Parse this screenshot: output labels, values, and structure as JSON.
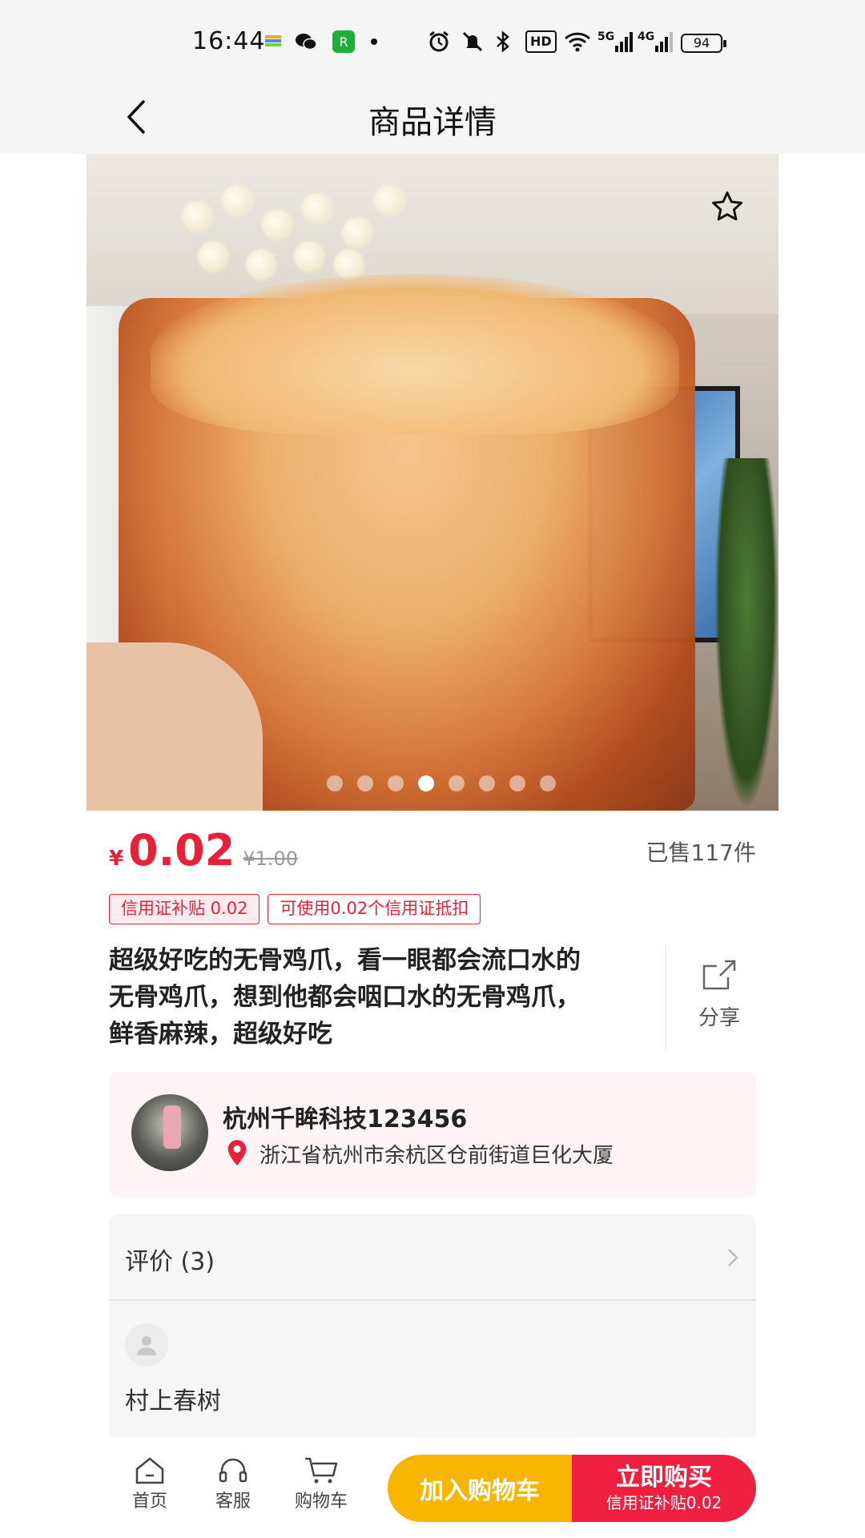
{
  "status_bar": {
    "time": "16:44",
    "icons": [
      "app-notification-icon",
      "wechat-icon",
      "app-icon",
      "dot-icon",
      "alarm-icon",
      "mute-icon",
      "bluetooth-icon",
      "hd-icon",
      "wifi-icon",
      "signal-5g-icon",
      "signal-4g-icon"
    ],
    "hd_label": "HD",
    "net1": "5G",
    "net2": "4G",
    "battery": "94"
  },
  "nav": {
    "title": "商品详情",
    "back_icon": "chevron-left-icon"
  },
  "gallery": {
    "favorite_icon": "star-outline-icon",
    "page_count": 8,
    "active_index": 3
  },
  "price": {
    "currency": "¥",
    "current": "0.02",
    "original": "¥1.00",
    "sold": "已售117件"
  },
  "tags": [
    "信用证补贴 0.02",
    "可使用0.02个信用证抵扣"
  ],
  "product": {
    "title_lines": [
      "超级好吃的无骨鸡爪，看一眼都会流口水的",
      "无骨鸡爪，想到他都会咽口水的无骨鸡爪，",
      "鲜香麻辣，超级好吃"
    ],
    "share_label": "分享"
  },
  "shop": {
    "name": "杭州千眸科技123456",
    "address": "浙江省杭州市余杭区仓前街道巨化大厦"
  },
  "reviews": {
    "title": "评价 (3)",
    "first_reviewer": "村上春树"
  },
  "bottom": {
    "tabs": [
      "首页",
      "客服",
      "购物车"
    ],
    "add_cart": "加入购物车",
    "buy_now": "立即购买",
    "buy_sub": "信用证补贴0.02"
  },
  "colors": {
    "accent": "#e8213b",
    "cart_button": "#f7b500",
    "buy_button": "#ef1f3f"
  }
}
